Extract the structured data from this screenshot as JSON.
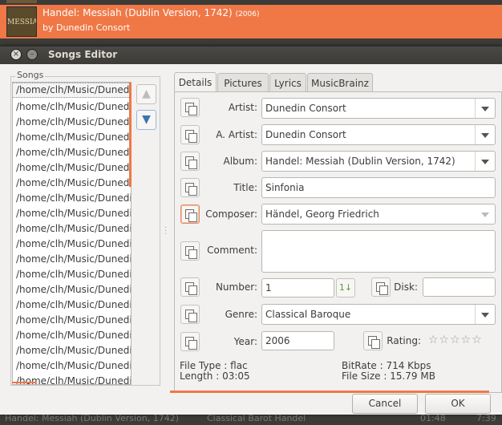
{
  "background": {
    "album_title": "Handel: Messiah (Dublin Version, 1742)",
    "album_year": "(2006)",
    "album_artist": "by Dunedin Consort",
    "thumb_text": "MESSIAH",
    "bottom_row": {
      "album": "Handel: Messiah (Dublin Version, 1742)",
      "genre": "Classical Barot Handel",
      "duration": "01:48",
      "last": "7:39"
    }
  },
  "dialog": {
    "title": "Songs Editor"
  },
  "songs": {
    "label": "Songs",
    "items": [
      "/home/clh/Music/Dunedin Consort",
      "/home/clh/Music/Dunedin Consort",
      "/home/clh/Music/Dunedin Consort",
      "/home/clh/Music/Dunedin Consort",
      "/home/clh/Music/Dunedin Consort",
      "/home/clh/Music/Dunedin Consort",
      "/home/clh/Music/Dunedin Consort",
      "/home/clh/Music/Dunedin Consort",
      "/home/clh/Music/Dunedin Consort",
      "/home/clh/Music/Dunedin Consort",
      "/home/clh/Music/Dunedin Consort",
      "/home/clh/Music/Dunedin Consort",
      "/home/clh/Music/Dunedin Consort",
      "/home/clh/Music/Dunedin Consort",
      "/home/clh/Music/Dunedin Consort",
      "/home/clh/Music/Dunedin Consort",
      "/home/clh/Music/Dunedin Consort",
      "/home/clh/Music/Dunedin Consort",
      "/home/clh/Music/Dunedin Consort",
      "/home/clh/Music/Dunedin Consort"
    ]
  },
  "tabs": [
    "Details",
    "Pictures",
    "Lyrics",
    "MusicBrainz"
  ],
  "details": {
    "artist_label": "Artist:",
    "artist": "Dunedin Consort",
    "album_artist_label": "A. Artist:",
    "album_artist": "Dunedin Consort",
    "album_label": "Album:",
    "album": "Handel: Messiah (Dublin Version, 1742)",
    "title_label": "Title:",
    "title": "Sinfonia",
    "composer_label": "Composer:",
    "composer": "Händel, Georg Friedrich",
    "comment_label": "Comment:",
    "comment": "",
    "number_label": "Number:",
    "number": "1",
    "disk_label": "Disk:",
    "disk": "",
    "genre_label": "Genre:",
    "genre": "Classical Baroque",
    "year_label": "Year:",
    "year": "2006",
    "rating_label": "Rating:",
    "rating_stars": "☆☆☆☆☆"
  },
  "file_info": {
    "file_type": "File Type   : flac",
    "length": "Length   : 03:05",
    "bitrate": "BitRate   : 714 Kbps",
    "file_size": "File Size : 15.79 MB"
  },
  "buttons": {
    "cancel": "Cancel",
    "ok": "OK"
  },
  "colors": {
    "accent": "#f07746",
    "titlebar": "#3c3b37"
  }
}
